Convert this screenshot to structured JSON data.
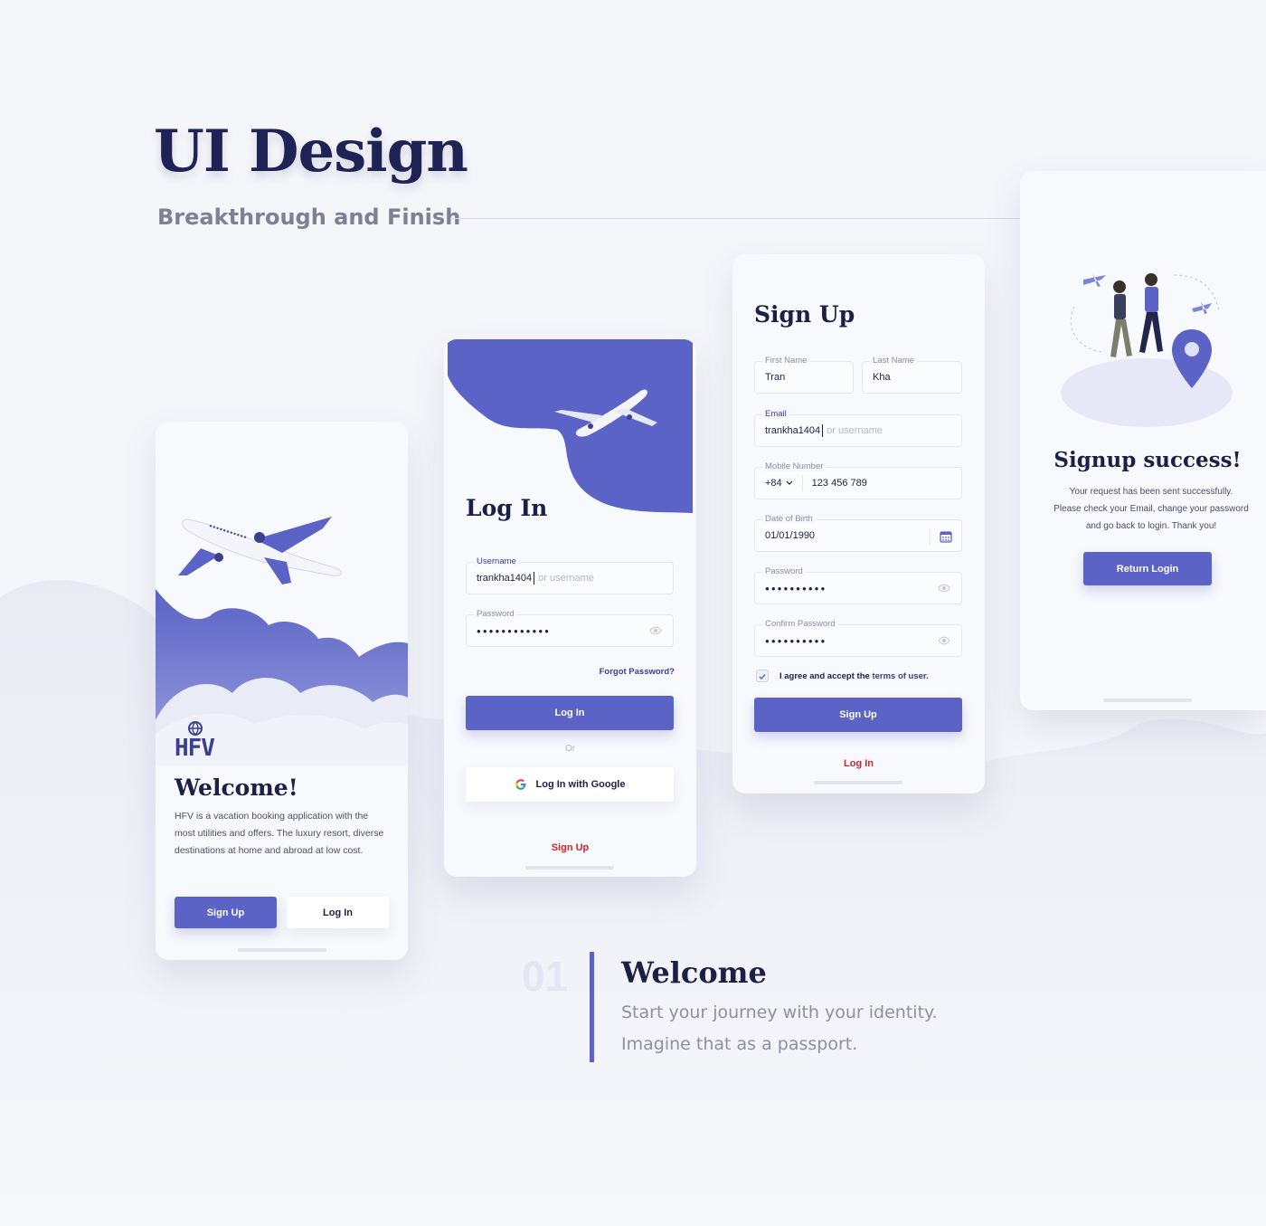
{
  "hero": {
    "title": "UI Design",
    "subtitle": "Breakthrough and Finish"
  },
  "welcome_screen": {
    "logo_text": "HFV",
    "title": "Welcome!",
    "description": "HFV is a vacation booking application with the most utilities and offers. The luxury resort, diverse destinations at home and abroad at low cost.",
    "signup_label": "Sign Up",
    "login_label": "Log In"
  },
  "login_screen": {
    "title": "Log In",
    "username_label": "Username",
    "username_value": "trankha1404",
    "username_placeholder": "or username",
    "password_label": "Password",
    "password_value": "●●●●●●●●●●●●",
    "forgot_label": "Forgot Password?",
    "login_label": "Log In",
    "or_label": "Or",
    "google_label": "Log In with Google",
    "signup_label": "Sign Up"
  },
  "signup_screen": {
    "title": "Sign Up",
    "first_name_label": "First Name",
    "first_name_value": "Tran",
    "last_name_label": "Last Name",
    "last_name_value": "Kha",
    "email_label": "Email",
    "email_value": "trankha1404",
    "email_placeholder": "or username",
    "mobile_label": "Mobile Number",
    "country_code": "+84",
    "mobile_value": "123 456 789",
    "dob_label": "Date of Birth",
    "dob_value": "01/01/1990",
    "password_label": "Password",
    "password_value": "●●●●●●●●●●",
    "confirm_label": "Confirm Password",
    "confirm_value": "●●●●●●●●●●",
    "agree_prefix": "I agree and accept the ",
    "agree_link": "terms of user.",
    "signup_label": "Sign Up",
    "login_label": "Log In"
  },
  "success_screen": {
    "title": "Signup success!",
    "line1": "Your request has been sent successfully.",
    "line2": "Please check your Email, change your password",
    "line3": "and go back to login. Thank you!",
    "button_label": "Return Login"
  },
  "section": {
    "number": "01",
    "title": "Welcome",
    "line1": "Start your journey with your identity.",
    "line2": "Imagine that as a passport."
  },
  "colors": {
    "accent": "#5b63c6",
    "navy": "#1d2046",
    "link_red": "#d0242d",
    "background": "#f5f6fa"
  },
  "icons": [
    "airplane-icon",
    "globe-icon",
    "eye-icon",
    "calendar-icon",
    "chevron-down-icon",
    "check-icon",
    "google-icon",
    "location-pin-icon"
  ]
}
